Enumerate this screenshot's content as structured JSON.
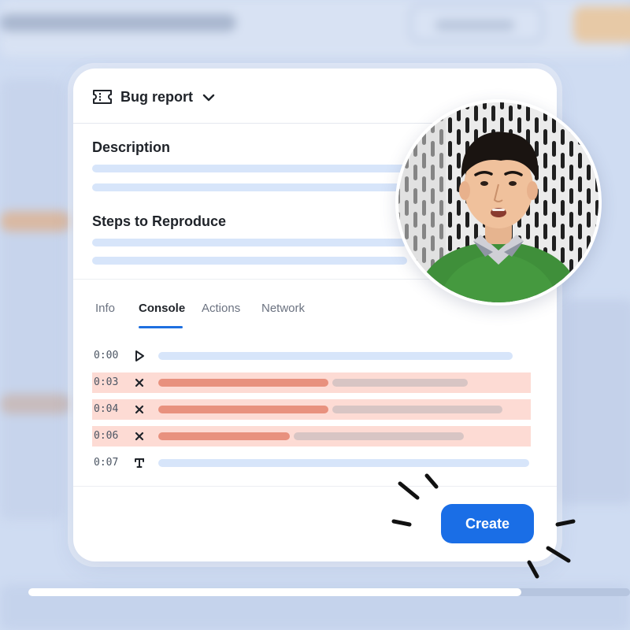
{
  "header": {
    "title": "Bug report",
    "icon": "ticket-icon",
    "dropdown_icon": "chevron-down-icon"
  },
  "sections": {
    "description": "Description",
    "steps": "Steps to Reproduce"
  },
  "tabs": [
    {
      "label": "Info",
      "active": false
    },
    {
      "label": "Console",
      "active": true
    },
    {
      "label": "Actions",
      "active": false
    },
    {
      "label": "Network",
      "active": false
    }
  ],
  "console": [
    {
      "time": "0:00",
      "icon": "play-icon",
      "status": "normal"
    },
    {
      "time": "0:03",
      "icon": "x-icon",
      "status": "error"
    },
    {
      "time": "0:04",
      "icon": "x-icon",
      "status": "error"
    },
    {
      "time": "0:06",
      "icon": "x-icon",
      "status": "error"
    },
    {
      "time": "0:07",
      "icon": "text-icon",
      "status": "normal"
    }
  ],
  "actions": {
    "create_label": "Create"
  },
  "playback": {
    "progress": 0.82
  },
  "colors": {
    "accent": "#1a6ee6",
    "error_row": "#fddbd4",
    "error_bar": "#e8917e",
    "placeholder_line": "#d7e5fa"
  }
}
